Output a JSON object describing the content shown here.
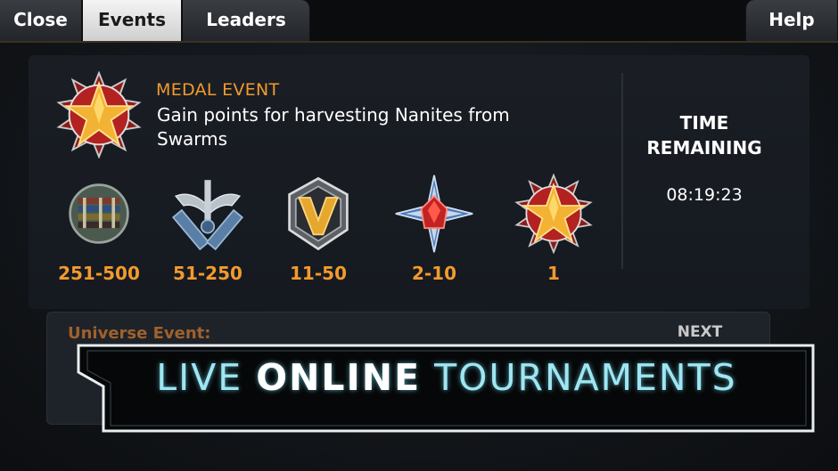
{
  "tabs": {
    "close": "Close",
    "events": "Events",
    "leaders": "Leaders",
    "help": "Help"
  },
  "event": {
    "type": "MEDAL EVENT",
    "description": "Gain points for harvesting Nanites from Swarms"
  },
  "rewards": [
    {
      "range": "251-500",
      "icon": "ribbon-bars-medal-icon"
    },
    {
      "range": "51-250",
      "icon": "crossed-swords-medal-icon"
    },
    {
      "range": "11-50",
      "icon": "chevron-v-medal-icon"
    },
    {
      "range": "2-10",
      "icon": "red-crystal-star-medal-icon"
    },
    {
      "range": "1",
      "icon": "gold-star-medal-icon"
    }
  ],
  "timer": {
    "title": "TIME REMAINING",
    "value": "08:19:23"
  },
  "universe_event": {
    "label": "Universe Event:",
    "next_label": "NEXT EVENT"
  },
  "banner": {
    "prefix": "LIVE ",
    "emphasis": "ONLINE",
    "suffix": " TOURNAMENTS"
  },
  "colors": {
    "accent_orange": "#f29a2e",
    "banner_cyan": "#9fe6f2",
    "active_tab": "#e8e8e8"
  }
}
